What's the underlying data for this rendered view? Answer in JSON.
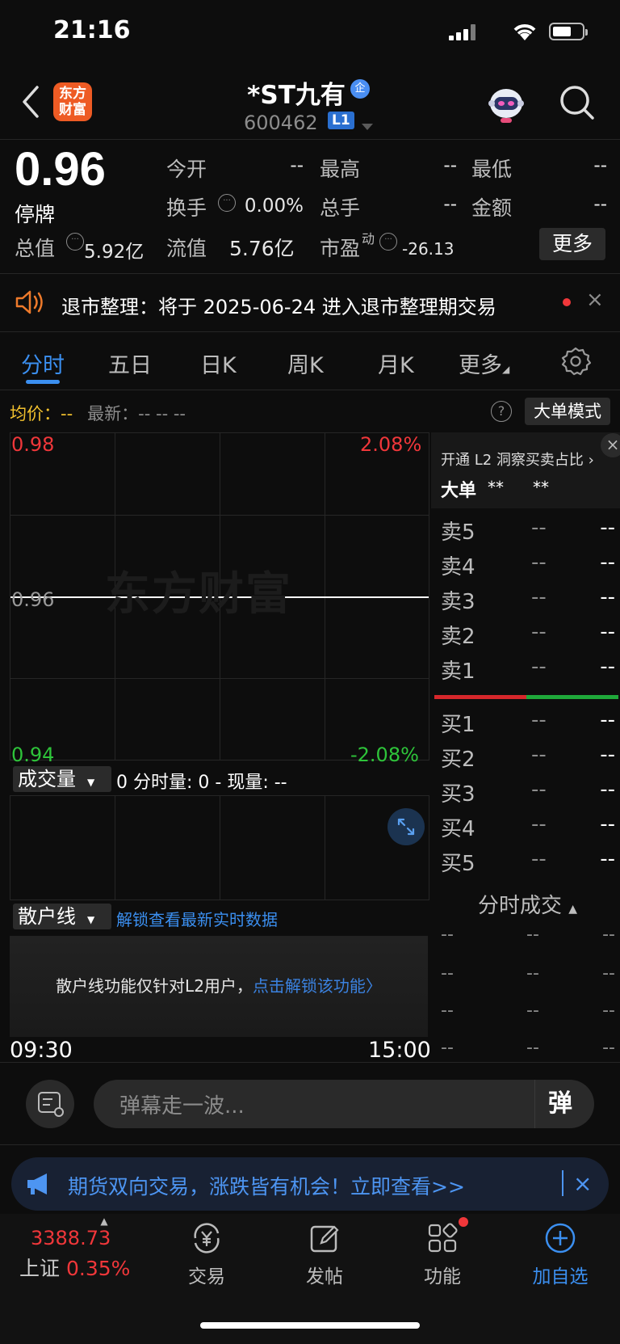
{
  "status_bar": {
    "time": "21:16"
  },
  "header": {
    "back_icon": "chevron-left-icon",
    "logo_text": [
      "东方",
      "财富"
    ],
    "stock_name": "*ST九有",
    "corp_badge": "企",
    "stock_code": "600462",
    "level_badge": "L1"
  },
  "quote": {
    "price": "0.96",
    "status": "停牌",
    "open_label": "今开",
    "open_value": "--",
    "high_label": "最高",
    "high_value": "--",
    "low_label": "最低",
    "low_value": "--",
    "turnover_label": "换手",
    "turnover_value": "0.00%",
    "volume_label": "总手",
    "volume_value": "--",
    "amount_label": "金额",
    "amount_value": "--",
    "mcap_label": "总值",
    "mcap_value": "5.92亿",
    "float_label": "流值",
    "float_value": "5.76亿",
    "pe_label": "市盈",
    "pe_sup": "动",
    "pe_value": "-26.13",
    "more_label": "更多"
  },
  "notice": {
    "text": "退市整理：将于 2025-06-24 进入退市整理期交易",
    "close": "×"
  },
  "tabs": [
    "分时",
    "五日",
    "日K",
    "周K",
    "月K",
    "更多"
  ],
  "chart_info": {
    "avg_label": "均价：",
    "avg_value": "--",
    "latest_label": "最新：",
    "latest_value": "-- -- --",
    "big_order_button": "大单模式",
    "help": "?"
  },
  "chart": {
    "top_price": "0.98",
    "top_pct": "2.08%",
    "mid_price": "0.96",
    "bottom_price": "0.94",
    "bottom_pct": "-2.08%",
    "watermark": "东方财富",
    "time_start": "09:30",
    "time_end": "15:00"
  },
  "volume": {
    "selector": "成交量",
    "text": "0 分时量: 0 - 现量: --"
  },
  "retail": {
    "selector": "散户线",
    "unlock_link": "解锁查看最新实时数据",
    "message": "散户线功能仅针对L2用户，",
    "message_link": "点击解锁该功能"
  },
  "order_book": {
    "promo": "开通 L2 洞察买卖占比",
    "big_label": "大单",
    "big_v1": "**",
    "big_v2": "**",
    "asks": [
      {
        "label": "卖5",
        "price": "--",
        "vol": "--"
      },
      {
        "label": "卖4",
        "price": "--",
        "vol": "--"
      },
      {
        "label": "卖3",
        "price": "--",
        "vol": "--"
      },
      {
        "label": "卖2",
        "price": "--",
        "vol": "--"
      },
      {
        "label": "卖1",
        "price": "--",
        "vol": "--"
      }
    ],
    "bids": [
      {
        "label": "买1",
        "price": "--",
        "vol": "--"
      },
      {
        "label": "买2",
        "price": "--",
        "vol": "--"
      },
      {
        "label": "买3",
        "price": "--",
        "vol": "--"
      },
      {
        "label": "买4",
        "price": "--",
        "vol": "--"
      },
      {
        "label": "买5",
        "price": "--",
        "vol": "--"
      }
    ],
    "trades_title": "分时成交",
    "trades": [
      [
        "--",
        "--",
        "--"
      ],
      [
        "--",
        "--",
        "--"
      ],
      [
        "--",
        "--",
        "--"
      ],
      [
        "--",
        "--",
        "--"
      ]
    ]
  },
  "danmaku": {
    "placeholder": "弹幕走一波...",
    "button": "弹"
  },
  "ad": {
    "text": "期货双向交易，涨跌皆有机会！立即查看>>",
    "close": "×"
  },
  "bottom_nav": {
    "index_value": "3388.73",
    "index_name": "上证",
    "index_pct": "0.35%",
    "items": [
      {
        "label": "交易",
        "icon": "trade-icon"
      },
      {
        "label": "发帖",
        "icon": "post-icon"
      },
      {
        "label": "功能",
        "icon": "apps-icon"
      },
      {
        "label": "加自选",
        "icon": "add-watchlist-icon"
      }
    ]
  },
  "colors": {
    "red": "#f0373a",
    "green": "#2ec43a",
    "blue": "#3b8ff0",
    "brand": "#ee5b24"
  }
}
